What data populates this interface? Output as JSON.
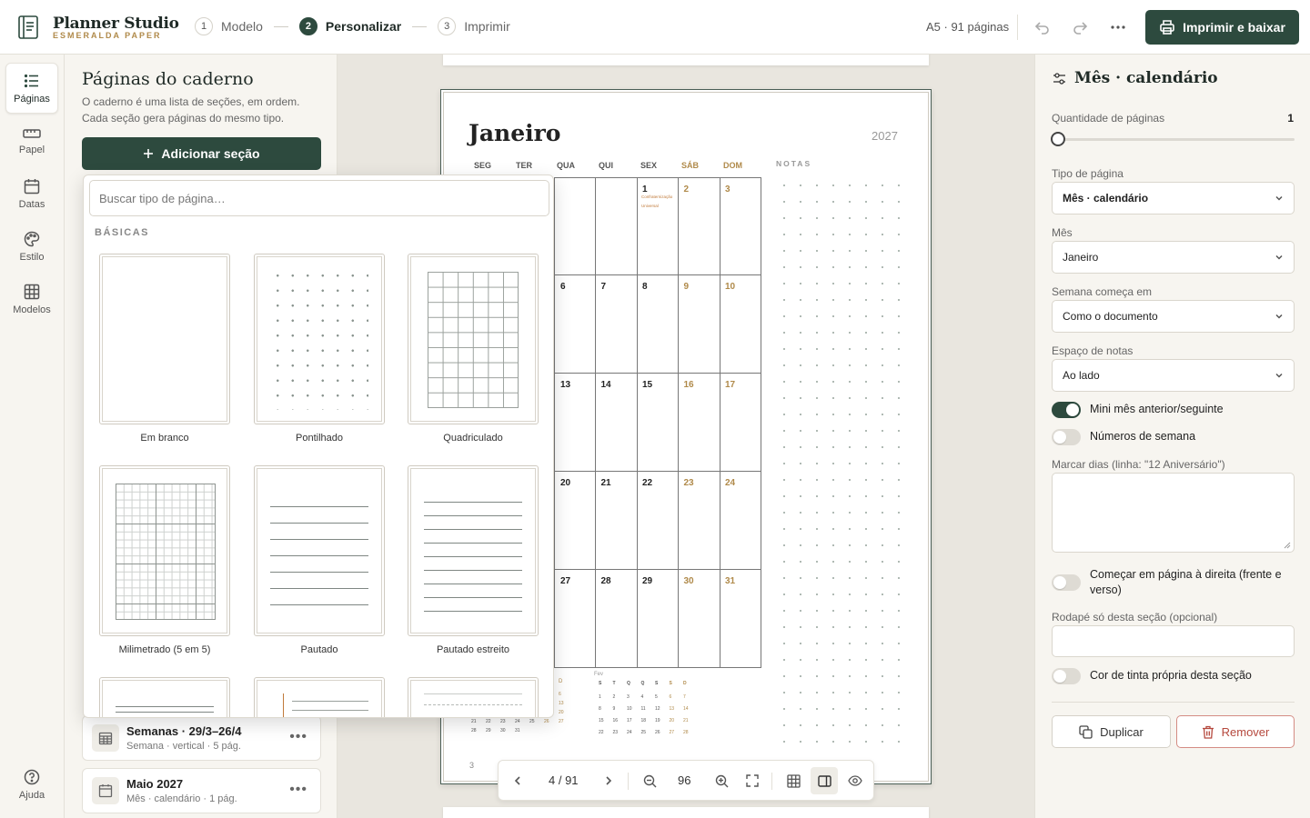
{
  "app": {
    "name": "Planner Studio",
    "subtitle": "ESMERALDA PAPER",
    "steps": [
      {
        "num": "1",
        "label": "Modelo"
      },
      {
        "num": "2",
        "label": "Personalizar"
      },
      {
        "num": "3",
        "label": "Imprimir"
      }
    ],
    "doc_info": "A5 · 91 páginas",
    "print_label": "Imprimir e baixar"
  },
  "rail": {
    "items": [
      {
        "label": "Páginas",
        "icon": "list-icon"
      },
      {
        "label": "Papel",
        "icon": "ruler-icon"
      },
      {
        "label": "Datas",
        "icon": "calendar-icon"
      },
      {
        "label": "Estilo",
        "icon": "palette-icon"
      },
      {
        "label": "Modelos",
        "icon": "grid-icon"
      }
    ],
    "help": "Ajuda"
  },
  "left": {
    "title": "Páginas do caderno",
    "desc": "O caderno é uma lista de seções, em ordem. Cada seção gera páginas do mesmo tipo.",
    "add_label": "Adicionar seção",
    "sections": [
      {
        "title": "Semanas · 29/3–26/4",
        "sub": "Semana · vertical · 5 pág."
      },
      {
        "title": "Maio 2027",
        "sub": "Mês · calendário · 1 pág."
      }
    ]
  },
  "picker": {
    "placeholder": "Buscar tipo de página…",
    "category": "BÁSICAS",
    "tiles": [
      "Em branco",
      "Pontilhado",
      "Quadriculado",
      "Milimetrado (5 em 5)",
      "Pautado",
      "Pautado estreito"
    ]
  },
  "preview": {
    "month": "Janeiro",
    "year": "2027",
    "weekdays": [
      "SEG",
      "TER",
      "QUA",
      "QUI",
      "SEX",
      "SÁB",
      "DOM"
    ],
    "notes_label": "NOTAS",
    "days_visible": [
      [
        "",
        "",
        "1",
        "2",
        "3"
      ],
      [
        "6",
        "7",
        "8",
        "9",
        "10"
      ],
      [
        "13",
        "14",
        "15",
        "16",
        "17"
      ],
      [
        "20",
        "21",
        "22",
        "23",
        "24"
      ],
      [
        "27",
        "28",
        "29",
        "30",
        "31"
      ]
    ],
    "event_lines": [
      "Confraternização",
      "Universal"
    ],
    "page_number": "3",
    "mini_prev": {
      "header": [
        "D"
      ],
      "rows": [
        [
          "6"
        ],
        [
          "13"
        ],
        [
          "20"
        ],
        [
          "21",
          "22",
          "23",
          "24",
          "25",
          "26",
          "27"
        ],
        [
          "28",
          "29",
          "30",
          "31"
        ]
      ]
    },
    "mini_next": {
      "title": "Fev",
      "header": [
        "S",
        "T",
        "Q",
        "Q",
        "S",
        "S",
        "D"
      ],
      "rows": [
        [
          "1",
          "2",
          "3",
          "4",
          "5",
          "6",
          "7"
        ],
        [
          "8",
          "9",
          "10",
          "11",
          "12",
          "13",
          "14"
        ],
        [
          "15",
          "16",
          "17",
          "18",
          "19",
          "20",
          "21"
        ],
        [
          "22",
          "23",
          "24",
          "25",
          "26",
          "27",
          "28"
        ]
      ]
    }
  },
  "zoombar": {
    "page_indicator": "4 / 91",
    "zoom": "96"
  },
  "right": {
    "title": "Mês · calendário",
    "qty_label": "Quantidade de páginas",
    "qty_value": "1",
    "qty_fraction": 0,
    "type_label": "Tipo de página",
    "type_value": "Mês · calendário",
    "month_label": "Mês",
    "month_value": "Janeiro",
    "week_label": "Semana começa em",
    "week_value": "Como o documento",
    "notes_label": "Espaço de notas",
    "notes_value": "Ao lado",
    "toggle_mini": "Mini mês anterior/seguinte",
    "toggle_week_numbers": "Números de semana",
    "mark_days_label": "Marcar dias (linha: \"12 Aniversário\")",
    "toggle_right_page": "Começar em página à direita (frente e verso)",
    "footer_label": "Rodapé só desta seção (opcional)",
    "toggle_ink": "Cor de tinta própria desta seção",
    "duplicate_label": "Duplicar",
    "remove_label": "Remover"
  },
  "colors": {
    "accent": "#2d4a3e",
    "gold": "#b08a4a",
    "danger": "#b5483d"
  }
}
